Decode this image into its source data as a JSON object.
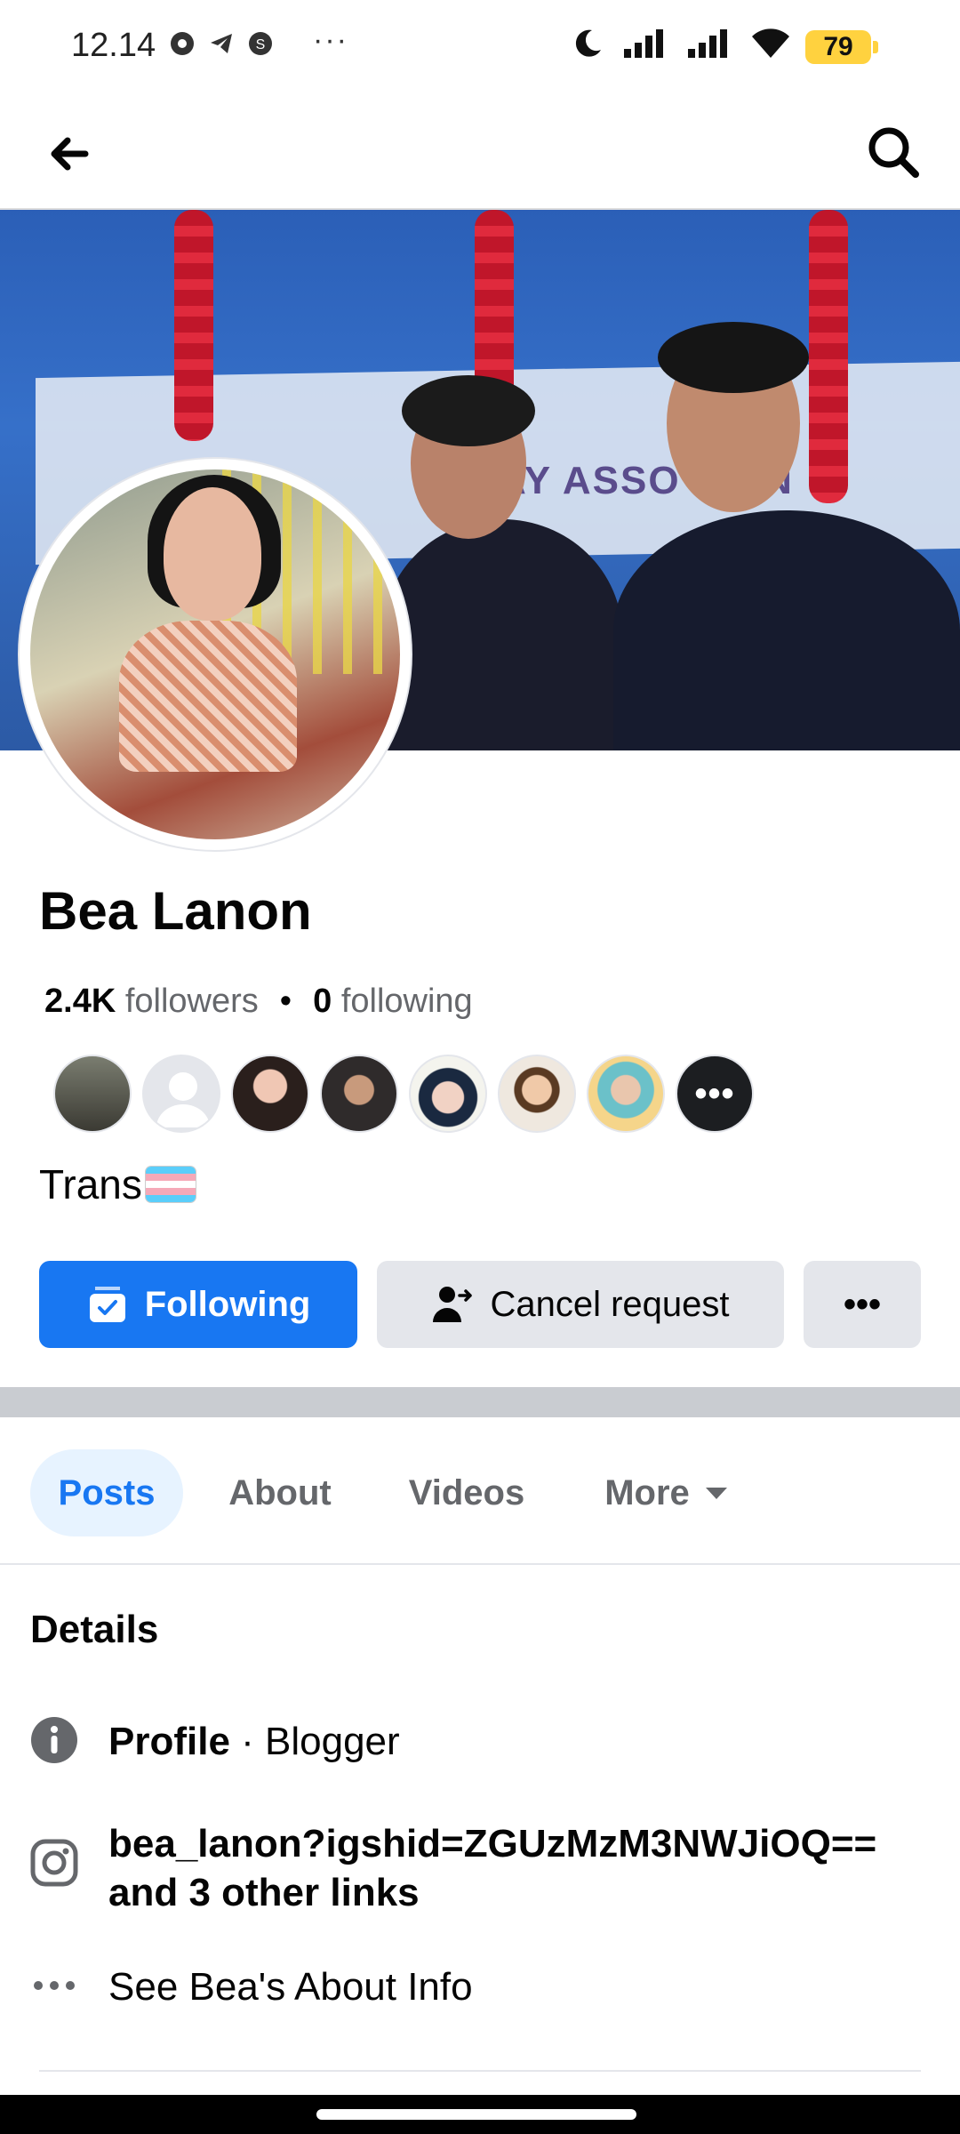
{
  "status_bar": {
    "time": "12.14",
    "dots": "···",
    "battery": "79",
    "icons": [
      "chrome-icon",
      "telegram-icon",
      "s-app-icon",
      "moon-icon",
      "signal-icon",
      "signal-icon",
      "wifi-icon"
    ]
  },
  "topnav": {
    "back_icon": "arrow-left-icon",
    "search_icon": "search-icon"
  },
  "cover": {
    "banner_text": "AY ASSO   TION"
  },
  "profile": {
    "name": "Bea Lanon",
    "followers_count": "2.4K",
    "followers_label": "followers",
    "separator": "•",
    "following_count": "0",
    "following_label": "following",
    "bio_text": "Trans",
    "more_friends": "•••"
  },
  "actions": {
    "following_label": "Following",
    "cancel_label": "Cancel request",
    "more_label": "•••"
  },
  "tabs": [
    {
      "label": "Posts",
      "active": true
    },
    {
      "label": "About",
      "active": false
    },
    {
      "label": "Videos",
      "active": false
    },
    {
      "label": "More",
      "active": false
    }
  ],
  "details": {
    "title": "Details",
    "profile_bold": "Profile",
    "profile_rest": " · Blogger",
    "links_line1": "bea_lanon?igshid=ZGUzMzM3NWJiOQ==",
    "links_line2": "and 3 other links",
    "see_about": "See Bea's About Info"
  },
  "colors": {
    "accent": "#1877f2",
    "button_gray": "#e4e6eb",
    "text_secondary": "#65676b",
    "battery": "#ffd23f"
  }
}
